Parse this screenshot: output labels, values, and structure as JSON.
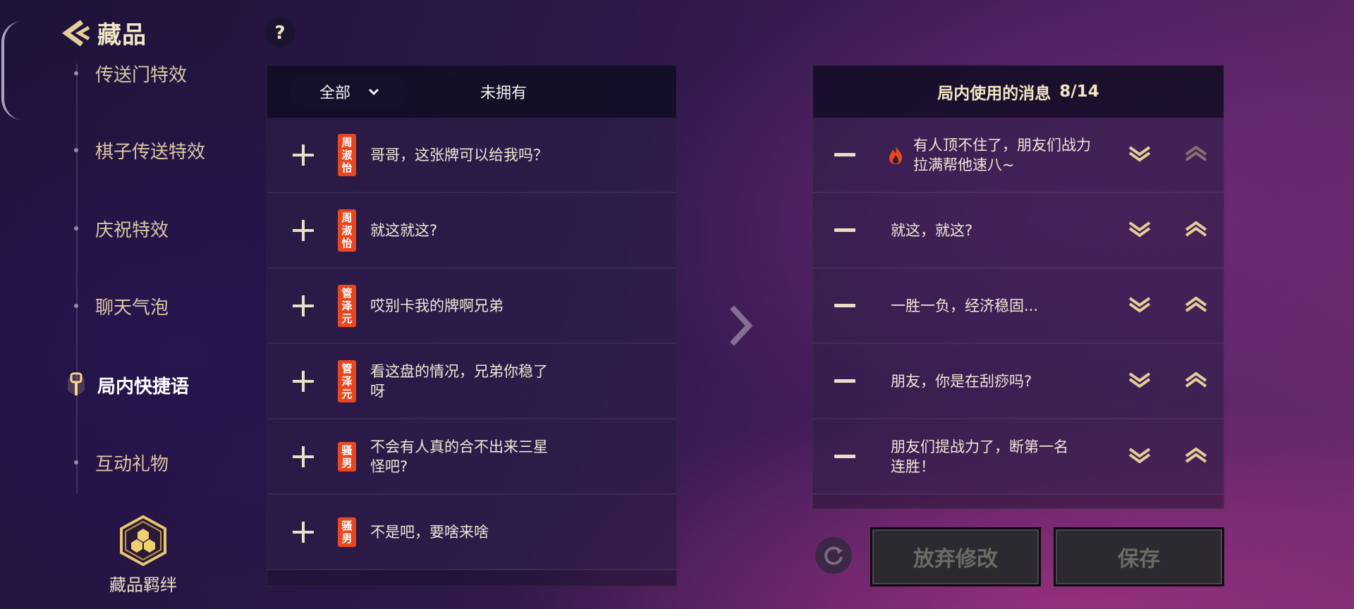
{
  "header": {
    "title": "藏品",
    "help": "?"
  },
  "nav": {
    "items": [
      {
        "label": "传送门特效",
        "active": false
      },
      {
        "label": "棋子传送特效",
        "active": false
      },
      {
        "label": "庆祝特效",
        "active": false
      },
      {
        "label": "聊天气泡",
        "active": false
      },
      {
        "label": "局内快捷语",
        "active": true
      },
      {
        "label": "互动礼物",
        "active": false
      }
    ],
    "bond_label": "藏品羁绊"
  },
  "filter": {
    "dropdown_value": "全部",
    "toggle_label": "未拥有"
  },
  "messages": [
    {
      "tag": "周淑怡",
      "text": "哥哥，这张牌可以给我吗？"
    },
    {
      "tag": "周淑怡",
      "text": "就这就这?"
    },
    {
      "tag": "管泽元",
      "text": "哎别卡我的牌啊兄弟"
    },
    {
      "tag": "管泽元",
      "text": "看这盘的情况，兄弟你稳了呀"
    },
    {
      "tag": "骚男",
      "text": "不会有人真的合不出来三星怪吧?"
    },
    {
      "tag": "骚男",
      "text": "不是吧，要啥来啥"
    }
  ],
  "used_panel": {
    "title": "局内使用的消息",
    "count": "8/14",
    "items": [
      {
        "text": "有人顶不住了，朋友们战力拉满帮他速八~",
        "hot": true
      },
      {
        "text": "就这，就这?",
        "hot": false
      },
      {
        "text": "一胜一负，经济稳固...",
        "hot": false
      },
      {
        "text": "朋友，你是在刮痧吗?",
        "hot": false
      },
      {
        "text": "朋友们提战力了，断第一名连胜！",
        "hot": false
      }
    ]
  },
  "buttons": {
    "discard": "放弃修改",
    "save": "保存"
  },
  "colors": {
    "tag_bg": "#e8481f",
    "accent_gold": "#e9dfc6",
    "fire": "#e8481f"
  }
}
